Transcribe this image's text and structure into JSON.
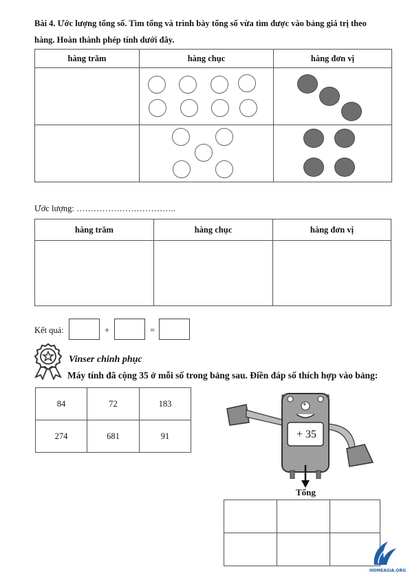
{
  "exercise4": {
    "title_line1": "Bài 4. Ước lượng tổng số. Tìm tổng và trình bày tổng số vừa tìm được vào bảng giá trị theo",
    "title_line2": "hàng. Hoàn thành phép tính dưới đây.",
    "table_headers": [
      "hàng trăm",
      "hàng chục",
      "hàng đơn vị"
    ],
    "estimate_label": "Ước lượng: ……………………………..",
    "result_label": "Kết quả:",
    "plus_sign": "+",
    "equals_sign": "="
  },
  "vinser": {
    "heading": "Vinser chinh phục",
    "instruction": "Máy tính đã cộng 35 ở mỗi số trong bảng sau. Điền đáp số thích hợp vào bảng:",
    "numbers": [
      [
        "84",
        "72",
        "183"
      ],
      [
        "274",
        "681",
        "91"
      ]
    ],
    "robot_screen": "+ 35",
    "robot_button": "+",
    "sum_label": "Tổng"
  },
  "watermark": {
    "text": "HOMEASIA.ORG"
  }
}
